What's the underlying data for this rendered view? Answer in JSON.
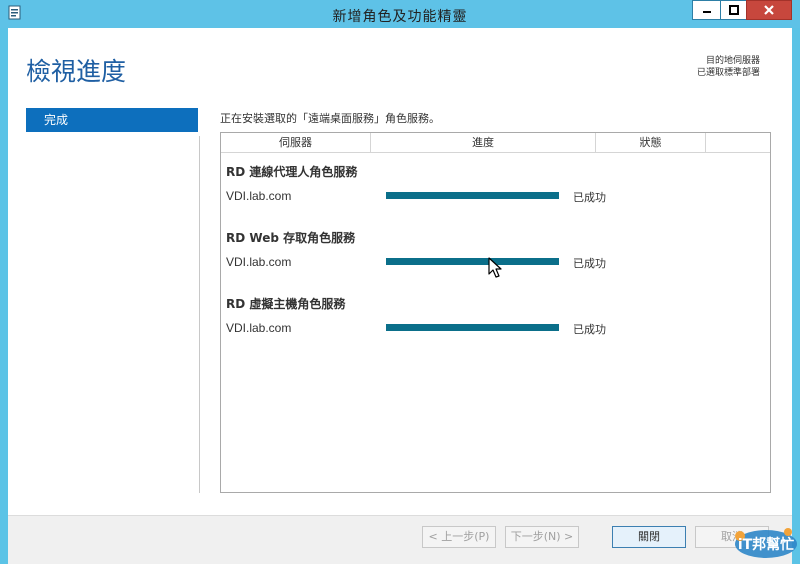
{
  "window": {
    "title": "新增角色及功能精靈"
  },
  "header": {
    "page_title": "檢視進度",
    "destination_label": "目的地伺服器",
    "destination_value": "已選取標準部署"
  },
  "nav": {
    "items": [
      {
        "label": "完成"
      }
    ]
  },
  "main": {
    "intro": "正在安裝選取的「遠端桌面服務」角色服務。",
    "columns": [
      "伺服器",
      "進度",
      "狀態"
    ],
    "groups": [
      {
        "title": "RD 連線代理人角色服務",
        "server": "VDI.lab.com",
        "progress": 1.0,
        "status": "已成功"
      },
      {
        "title": "RD Web 存取角色服務",
        "server": "VDI.lab.com",
        "progress": 1.0,
        "status": "已成功"
      },
      {
        "title": "RD 虛擬主機角色服務",
        "server": "VDI.lab.com",
        "progress": 1.0,
        "status": "已成功"
      }
    ]
  },
  "footer": {
    "prev_label": "< 上一步(P)",
    "next_label": "下一步(N) >",
    "close_label": "關閉",
    "cancel_label": "取消"
  },
  "watermark": {
    "text": "iT邦幫忙"
  },
  "colors": {
    "titlebar": "#5ec2e7",
    "accent": "#1f5fa3",
    "nav_selected": "#0d6fbd",
    "progress_fill": "#0b6f8a",
    "close_button": "#c7473d"
  },
  "icons": {
    "app": "server-manager-icon",
    "minimize": "minimize-icon",
    "maximize": "maximize-icon",
    "close": "close-icon"
  }
}
